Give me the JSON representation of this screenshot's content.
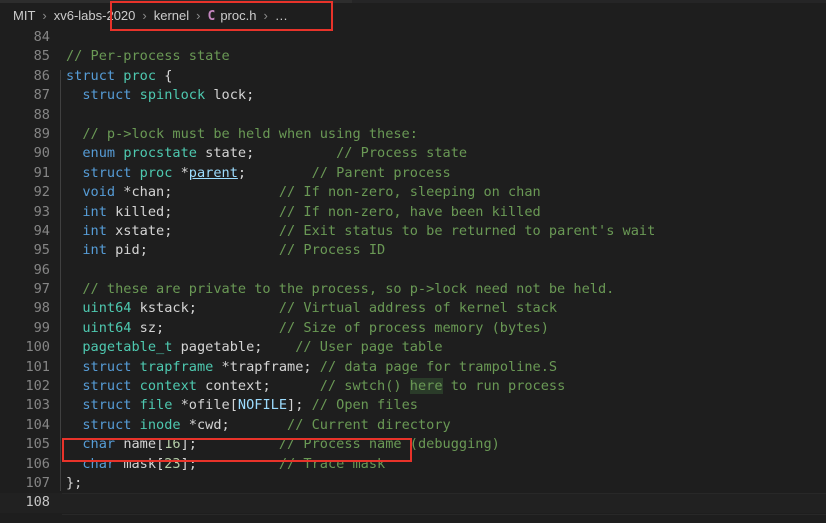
{
  "window": {
    "app": "vscode-editor",
    "background": "#1e1e1e"
  },
  "breadcrumb": {
    "name": "breadcrumb",
    "separator": "›",
    "items": [
      {
        "label": "MIT",
        "kind": "folder"
      },
      {
        "label": "xv6-labs-2020",
        "kind": "folder"
      },
      {
        "label": "kernel",
        "kind": "folder"
      },
      {
        "label": "proc.h",
        "kind": "file",
        "icon": "c-file-icon",
        "icon_glyph": "C",
        "icon_color": "#c586c0"
      },
      {
        "label": "…",
        "kind": "symbol-overflow"
      }
    ]
  },
  "annotations": [
    {
      "name": "breadcrumb-highlight-box",
      "color": "#e8332a",
      "target": "breadcrumb path proc.h"
    },
    {
      "name": "mask-line-highlight-box",
      "color": "#e8332a",
      "target": "line 106 char mask[23]"
    }
  ],
  "editor": {
    "file": "proc.h",
    "language": "C",
    "first_visible_line": 84,
    "last_visible_line": 108,
    "current_line": 108,
    "colors": {
      "keyword": "#569cd6",
      "type": "#4ec9b0",
      "variable": "#d4d4d4",
      "constant": "#9cdcfe",
      "number": "#b5cea8",
      "comment": "#6a9955",
      "line_number": "#858585",
      "line_number_active": "#c6c6c6",
      "background": "#1e1e1e",
      "indent_guide": "#404040"
    },
    "lines": [
      {
        "n": 84,
        "indent": 0,
        "tokens": []
      },
      {
        "n": 85,
        "indent": 1,
        "tokens": [
          {
            "t": "cmt",
            "v": "// Per-process state"
          }
        ]
      },
      {
        "n": 86,
        "indent": 1,
        "tokens": [
          {
            "t": "kw",
            "v": "struct"
          },
          {
            "t": "pun",
            "v": " "
          },
          {
            "t": "typ",
            "v": "proc"
          },
          {
            "t": "pun",
            "v": " {"
          }
        ]
      },
      {
        "n": 87,
        "indent": 2,
        "tokens": [
          {
            "t": "kw",
            "v": "struct"
          },
          {
            "t": "pun",
            "v": " "
          },
          {
            "t": "typ",
            "v": "spinlock"
          },
          {
            "t": "pun",
            "v": " "
          },
          {
            "t": "var",
            "v": "lock"
          },
          {
            "t": "pun",
            "v": ";"
          }
        ]
      },
      {
        "n": 88,
        "indent": 1,
        "tokens": []
      },
      {
        "n": 89,
        "indent": 2,
        "tokens": [
          {
            "t": "cmt",
            "v": "// p->lock must be held when using these:"
          }
        ]
      },
      {
        "n": 90,
        "indent": 2,
        "tokens": [
          {
            "t": "kw",
            "v": "enum"
          },
          {
            "t": "pun",
            "v": " "
          },
          {
            "t": "typ",
            "v": "procstate"
          },
          {
            "t": "pun",
            "v": " "
          },
          {
            "t": "var",
            "v": "state"
          },
          {
            "t": "pun",
            "v": ";"
          },
          {
            "t": "pad",
            "v": "          "
          },
          {
            "t": "cmt",
            "v": "// Process state"
          }
        ]
      },
      {
        "n": 91,
        "indent": 2,
        "tokens": [
          {
            "t": "kw",
            "v": "struct"
          },
          {
            "t": "pun",
            "v": " "
          },
          {
            "t": "typ",
            "v": "proc"
          },
          {
            "t": "pun",
            "v": " *"
          },
          {
            "t": "lnk",
            "v": "parent"
          },
          {
            "t": "pun",
            "v": ";"
          },
          {
            "t": "pad",
            "v": "        "
          },
          {
            "t": "cmt",
            "v": "// Parent process"
          }
        ]
      },
      {
        "n": 92,
        "indent": 2,
        "tokens": [
          {
            "t": "kw",
            "v": "void"
          },
          {
            "t": "pun",
            "v": " *"
          },
          {
            "t": "var",
            "v": "chan"
          },
          {
            "t": "pun",
            "v": ";"
          },
          {
            "t": "pad",
            "v": "             "
          },
          {
            "t": "cmt",
            "v": "// If non-zero, sleeping on chan"
          }
        ]
      },
      {
        "n": 93,
        "indent": 2,
        "tokens": [
          {
            "t": "kw",
            "v": "int"
          },
          {
            "t": "pun",
            "v": " "
          },
          {
            "t": "var",
            "v": "killed"
          },
          {
            "t": "pun",
            "v": ";"
          },
          {
            "t": "pad",
            "v": "             "
          },
          {
            "t": "cmt",
            "v": "// If non-zero, have been killed"
          }
        ]
      },
      {
        "n": 94,
        "indent": 2,
        "tokens": [
          {
            "t": "kw",
            "v": "int"
          },
          {
            "t": "pun",
            "v": " "
          },
          {
            "t": "var",
            "v": "xstate"
          },
          {
            "t": "pun",
            "v": ";"
          },
          {
            "t": "pad",
            "v": "             "
          },
          {
            "t": "cmt",
            "v": "// Exit status to be returned to parent's wait"
          }
        ]
      },
      {
        "n": 95,
        "indent": 2,
        "tokens": [
          {
            "t": "kw",
            "v": "int"
          },
          {
            "t": "pun",
            "v": " "
          },
          {
            "t": "var",
            "v": "pid"
          },
          {
            "t": "pun",
            "v": ";"
          },
          {
            "t": "pad",
            "v": "                "
          },
          {
            "t": "cmt",
            "v": "// Process ID"
          }
        ]
      },
      {
        "n": 96,
        "indent": 1,
        "tokens": []
      },
      {
        "n": 97,
        "indent": 2,
        "tokens": [
          {
            "t": "cmt",
            "v": "// these are private to the process, so p->lock need not be held."
          }
        ]
      },
      {
        "n": 98,
        "indent": 2,
        "tokens": [
          {
            "t": "typ",
            "v": "uint64"
          },
          {
            "t": "pun",
            "v": " "
          },
          {
            "t": "var",
            "v": "kstack"
          },
          {
            "t": "pun",
            "v": ";"
          },
          {
            "t": "pad",
            "v": "          "
          },
          {
            "t": "cmt",
            "v": "// Virtual address of kernel stack"
          }
        ]
      },
      {
        "n": 99,
        "indent": 2,
        "tokens": [
          {
            "t": "typ",
            "v": "uint64"
          },
          {
            "t": "pun",
            "v": " "
          },
          {
            "t": "var",
            "v": "sz"
          },
          {
            "t": "pun",
            "v": ";"
          },
          {
            "t": "pad",
            "v": "              "
          },
          {
            "t": "cmt",
            "v": "// Size of process memory (bytes)"
          }
        ]
      },
      {
        "n": 100,
        "indent": 2,
        "tokens": [
          {
            "t": "typ",
            "v": "pagetable_t"
          },
          {
            "t": "pun",
            "v": " "
          },
          {
            "t": "var",
            "v": "pagetable"
          },
          {
            "t": "pun",
            "v": ";"
          },
          {
            "t": "pad",
            "v": "    "
          },
          {
            "t": "cmt",
            "v": "// User page table"
          }
        ]
      },
      {
        "n": 101,
        "indent": 2,
        "tokens": [
          {
            "t": "kw",
            "v": "struct"
          },
          {
            "t": "pun",
            "v": " "
          },
          {
            "t": "typ",
            "v": "trapframe"
          },
          {
            "t": "pun",
            "v": " *"
          },
          {
            "t": "var",
            "v": "trapframe"
          },
          {
            "t": "pun",
            "v": ";"
          },
          {
            "t": "pad",
            "v": " "
          },
          {
            "t": "cmt",
            "v": "// data page for trampoline.S"
          }
        ]
      },
      {
        "n": 102,
        "indent": 2,
        "tokens": [
          {
            "t": "kw",
            "v": "struct"
          },
          {
            "t": "pun",
            "v": " "
          },
          {
            "t": "typ",
            "v": "context"
          },
          {
            "t": "pun",
            "v": " "
          },
          {
            "t": "var",
            "v": "context"
          },
          {
            "t": "pun",
            "v": ";"
          },
          {
            "t": "pad",
            "v": "      "
          },
          {
            "t": "cmt",
            "v": "// swtch() "
          },
          {
            "t": "cmt-hl",
            "v": "here"
          },
          {
            "t": "cmt",
            "v": " to run process"
          }
        ]
      },
      {
        "n": 103,
        "indent": 2,
        "tokens": [
          {
            "t": "kw",
            "v": "struct"
          },
          {
            "t": "pun",
            "v": " "
          },
          {
            "t": "typ",
            "v": "file"
          },
          {
            "t": "pun",
            "v": " *"
          },
          {
            "t": "var",
            "v": "ofile"
          },
          {
            "t": "pun",
            "v": "["
          },
          {
            "t": "con",
            "v": "NOFILE"
          },
          {
            "t": "pun",
            "v": "];"
          },
          {
            "t": "pad",
            "v": " "
          },
          {
            "t": "cmt",
            "v": "// Open files"
          }
        ]
      },
      {
        "n": 104,
        "indent": 2,
        "tokens": [
          {
            "t": "kw",
            "v": "struct"
          },
          {
            "t": "pun",
            "v": " "
          },
          {
            "t": "typ",
            "v": "inode"
          },
          {
            "t": "pun",
            "v": " *"
          },
          {
            "t": "var",
            "v": "cwd"
          },
          {
            "t": "pun",
            "v": ";"
          },
          {
            "t": "pad",
            "v": "       "
          },
          {
            "t": "cmt",
            "v": "// Current directory"
          }
        ]
      },
      {
        "n": 105,
        "indent": 2,
        "tokens": [
          {
            "t": "kw",
            "v": "char"
          },
          {
            "t": "pun",
            "v": " "
          },
          {
            "t": "var",
            "v": "name"
          },
          {
            "t": "pun",
            "v": "["
          },
          {
            "t": "num",
            "v": "16"
          },
          {
            "t": "pun",
            "v": "];"
          },
          {
            "t": "pad",
            "v": "          "
          },
          {
            "t": "cmt",
            "v": "// Process name (debugging)"
          }
        ]
      },
      {
        "n": 106,
        "indent": 2,
        "tokens": [
          {
            "t": "kw",
            "v": "char"
          },
          {
            "t": "pun",
            "v": " "
          },
          {
            "t": "var",
            "v": "mask"
          },
          {
            "t": "pun",
            "v": "["
          },
          {
            "t": "num",
            "v": "23"
          },
          {
            "t": "pun",
            "v": "];"
          },
          {
            "t": "pad",
            "v": "          "
          },
          {
            "t": "cmt",
            "v": "// Trace mask"
          }
        ]
      },
      {
        "n": 107,
        "indent": 1,
        "tokens": [
          {
            "t": "pun",
            "v": "};"
          }
        ]
      },
      {
        "n": 108,
        "indent": 0,
        "tokens": []
      }
    ]
  }
}
